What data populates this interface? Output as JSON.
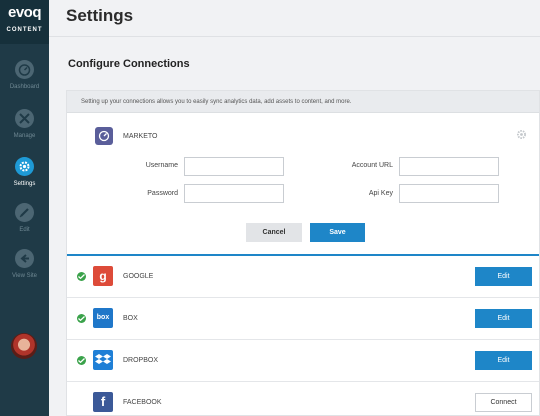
{
  "sidebar": {
    "logo": "evoq",
    "logo_sub": "CONTENT",
    "items": [
      {
        "label": "Dashboard",
        "icon": "dashboard-icon"
      },
      {
        "label": "Manage",
        "icon": "manage-icon"
      },
      {
        "label": "Settings",
        "icon": "gear-icon",
        "active": true
      },
      {
        "label": "Edit",
        "icon": "pencil-icon"
      },
      {
        "label": "View Site",
        "icon": "exit-icon"
      }
    ]
  },
  "page": {
    "title": "Settings",
    "section_title": "Configure Connections",
    "info_text": "Setting up your connections allows you to easily sync analytics data, add assets to content, and more."
  },
  "marketo": {
    "name": "MARKETO",
    "fields": {
      "username_label": "Username",
      "password_label": "Password",
      "account_url_label": "Account URL",
      "api_key_label": "Api Key",
      "username_value": "",
      "password_value": "",
      "account_url_value": "",
      "api_key_value": ""
    },
    "cancel_label": "Cancel",
    "save_label": "Save"
  },
  "connections": [
    {
      "name": "GOOGLE",
      "connected": true,
      "action": "Edit",
      "icon_glyph": "g",
      "color": "#dd4b39"
    },
    {
      "name": "BOX",
      "connected": true,
      "action": "Edit",
      "icon_glyph": "box",
      "color": "#1f77c9"
    },
    {
      "name": "DROPBOX",
      "connected": true,
      "action": "Edit",
      "icon_glyph": "dropbox",
      "color": "#1f7fd6"
    },
    {
      "name": "FACEBOOK",
      "connected": false,
      "action": "Connect",
      "icon_glyph": "f",
      "color": "#3b5998"
    }
  ],
  "colors": {
    "sidebar_bg": "#1f3a47",
    "accent": "#1e86c8",
    "active_nav": "#1e9ad6",
    "connected_check": "#3aa24a"
  }
}
